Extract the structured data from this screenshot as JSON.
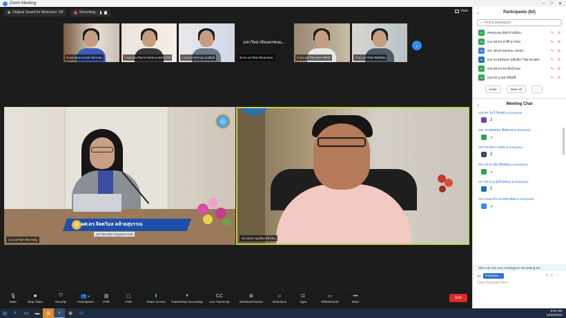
{
  "window": {
    "title": "Zoom Meeting"
  },
  "topbar": {
    "sound_label": "Original Sound for Musicians: Off",
    "recording_label": "Recording...",
    "view_label": "View"
  },
  "filmstrip": [
    {
      "name": "028 ผศ.ดร.ดวงพร นิลวรรณ"
    },
    {
      "name": "040 คณะวิทยาศาสตร์และเทคโนโลยี"
    },
    {
      "name": "044 ดร.ชัยชาญ นามพิมพ์"
    },
    {
      "big": "มหาวิทยาลัยนครพนม...",
      "name": "030 มหาวิทยาลัยนครพนม"
    },
    {
      "name": "041 มหาวิทยาลัยกาฬสินธุ์"
    },
    {
      "name": "014 มหาวิทยาลัยทักษิณ"
    }
  ],
  "speakers": {
    "left_banner": "ผศ.ดร.จิตตวิมล คล้ายสุบรรณ",
    "left_banner_sub": "มหาวิทยาลัยราชภัฏนครสวรรค์",
    "left_name": "002 มหาวิทยาลัยราชภัฏ",
    "right_name": "003 ผศ.ดร.บุญเรือง ศรีเหรัญ"
  },
  "toolbar": [
    {
      "label": "Mute",
      "icon": "mic-icon",
      "glyph": "🎙"
    },
    {
      "label": "Stop Video",
      "icon": "video-icon",
      "glyph": "■"
    },
    {
      "label": "Security",
      "icon": "shield-icon",
      "glyph": "⛉"
    },
    {
      "label": "Participants",
      "icon": "participants-icon",
      "glyph": "👥",
      "badge": "67"
    },
    {
      "label": "Polls",
      "icon": "polls-icon",
      "glyph": "▥"
    },
    {
      "label": "Chat",
      "icon": "chat-icon",
      "glyph": "▢"
    },
    {
      "label": "Share Screen",
      "icon": "share-screen-icon",
      "glyph": "⬆",
      "green": true
    },
    {
      "label": "Pause/Stop Recording",
      "icon": "recording-icon",
      "glyph": "⏸"
    },
    {
      "label": "Live Transcript",
      "icon": "transcript-icon",
      "glyph": "CC"
    },
    {
      "label": "Breakout Rooms",
      "icon": "breakout-icon",
      "glyph": "⊞"
    },
    {
      "label": "Reactions",
      "icon": "reactions-icon",
      "glyph": "☺"
    },
    {
      "label": "Apps",
      "icon": "apps-icon",
      "glyph": "⊡"
    },
    {
      "label": "Whiteboards",
      "icon": "whiteboard-icon",
      "glyph": "▭"
    },
    {
      "label": "More",
      "icon": "more-icon",
      "glyph": "•••"
    }
  ],
  "end_label": "End",
  "participants": {
    "title": "Participants (62)",
    "search_placeholder": "Find a participant",
    "items": [
      {
        "initials": "0c",
        "name": "ครคณะทมุ ศิลป์ ฝ่ายอิสระ",
        "color": "#2aa44f"
      },
      {
        "initials": "04",
        "name": "041-รศ.ดร.สาสิริ สุวรรณ",
        "color": "#2aa44f"
      },
      {
        "initials": "00",
        "name": "001 รศ.ดร.จอมชนะ ทองสา",
        "color": "#3c7bd6"
      },
      {
        "initials": "04",
        "name": "044 ชวนชนินทร มณีเขียว วิทยาศาสตร",
        "color": "#1f6fb6"
      },
      {
        "initials": "00",
        "name": "005 ผศ.ดร.คน่ ศิลป์เกษม",
        "color": "#2aa44f"
      },
      {
        "initials": "04",
        "name": "040 ดร.ภูวดล ศรีสุทธิ์",
        "color": "#2aa44f"
      }
    ],
    "invite_label": "Invite",
    "mute_all_label": "Mute All",
    "more_label": "..."
  },
  "chat": {
    "title": "Meeting Chat",
    "messages": [
      {
        "from": "018 ดร.วัน ก็ ชิมพลี to Everyone",
        "text": "2",
        "avatar": "#7b3fb3"
      },
      {
        "from": "005 ชวนชัยชนัน ฟืตลีลาศ to Everyone",
        "text": "✓",
        "avatar": "#2aa44f"
      },
      {
        "from": "003 ดร.สุรภา ก่อกัน to Everyone",
        "text": "2",
        "avatar": "#3a4a60"
      },
      {
        "from": "001 ดร.ดาเนีย ศรีพลัพยู to Everyone",
        "text": "✓",
        "avatar": "#2aa44f"
      },
      {
        "from": "017 ดร.ระนุ ลุ่ยภิเขยันเย to Everyone",
        "text": "2",
        "avatar": "#1f6fb6"
      },
      {
        "from": "013 ชวนจ ลำเวน สุทนาดีสม to Everyone",
        "text": "✓",
        "avatar": "#2d8cff"
      }
    ],
    "notice": "Who can see your messages? Recording On",
    "to_label": "To:",
    "to_value": "Everyone ⌄",
    "input_placeholder": "Type message here..."
  },
  "taskbar": {
    "time": "9:51 AM",
    "date": "12/22/2022"
  }
}
